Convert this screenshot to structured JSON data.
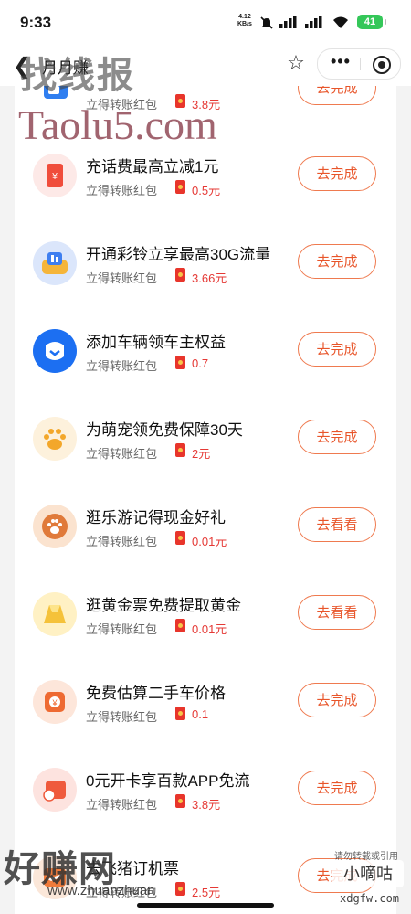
{
  "status_bar": {
    "time": "9:33",
    "net_speed": "4.12",
    "net_unit": "KB/s",
    "battery": "41"
  },
  "nav": {
    "title": "月月赚"
  },
  "tasks": [
    {
      "title": "",
      "sub": "立得转账红包",
      "amount": "3.8元",
      "button": "去完成",
      "icon": "wallet-icon"
    },
    {
      "title": "充话费最高立减1元",
      "sub": "立得转账红包",
      "amount": "0.5元",
      "button": "去完成",
      "icon": "phone-recharge-icon"
    },
    {
      "title": "开通彩铃立享最高30G流量",
      "sub": "立得转账红包",
      "amount": "3.66元",
      "button": "去完成",
      "icon": "ringtone-icon"
    },
    {
      "title": "添加车辆领车主权益",
      "sub": "立得转账红包",
      "amount": "0.7",
      "button": "去完成",
      "icon": "car-owner-icon"
    },
    {
      "title": "为萌宠领免费保障30天",
      "sub": "立得转账红包",
      "amount": "2元",
      "button": "去完成",
      "icon": "pet-paw-icon"
    },
    {
      "title": "逛乐游记得现金好礼",
      "sub": "立得转账红包",
      "amount": "0.01元",
      "button": "去看看",
      "icon": "paw-badge-icon"
    },
    {
      "title": "逛黄金票免费提取黄金",
      "sub": "立得转账红包",
      "amount": "0.01元",
      "button": "去看看",
      "icon": "gold-bar-icon"
    },
    {
      "title": "免费估算二手车价格",
      "sub": "立得转账红包",
      "amount": "0.1",
      "button": "去完成",
      "icon": "price-estimate-icon"
    },
    {
      "title": "0元开卡享百款APP免流",
      "sub": "立得转账红包",
      "amount": "3.8元",
      "button": "去完成",
      "icon": "sim-card-icon"
    },
    {
      "title": "去飞猪订机票",
      "sub": "立得转账红包",
      "amount": "2.5元",
      "button": "去完成",
      "icon": "flight-icon"
    }
  ],
  "watermarks": {
    "top_cn": "找线报",
    "top_en": "Taolu5.com",
    "bottom_cn": "好赚网",
    "bottom_url": "www.zhuanzhuan",
    "badge": "小嘀咕",
    "badge_small": "请勿转载或引用",
    "badge_url": "xdgfw.com"
  },
  "colors": {
    "accent": "#e8552a",
    "amount": "#e53935",
    "background": "#f3f3f3"
  }
}
